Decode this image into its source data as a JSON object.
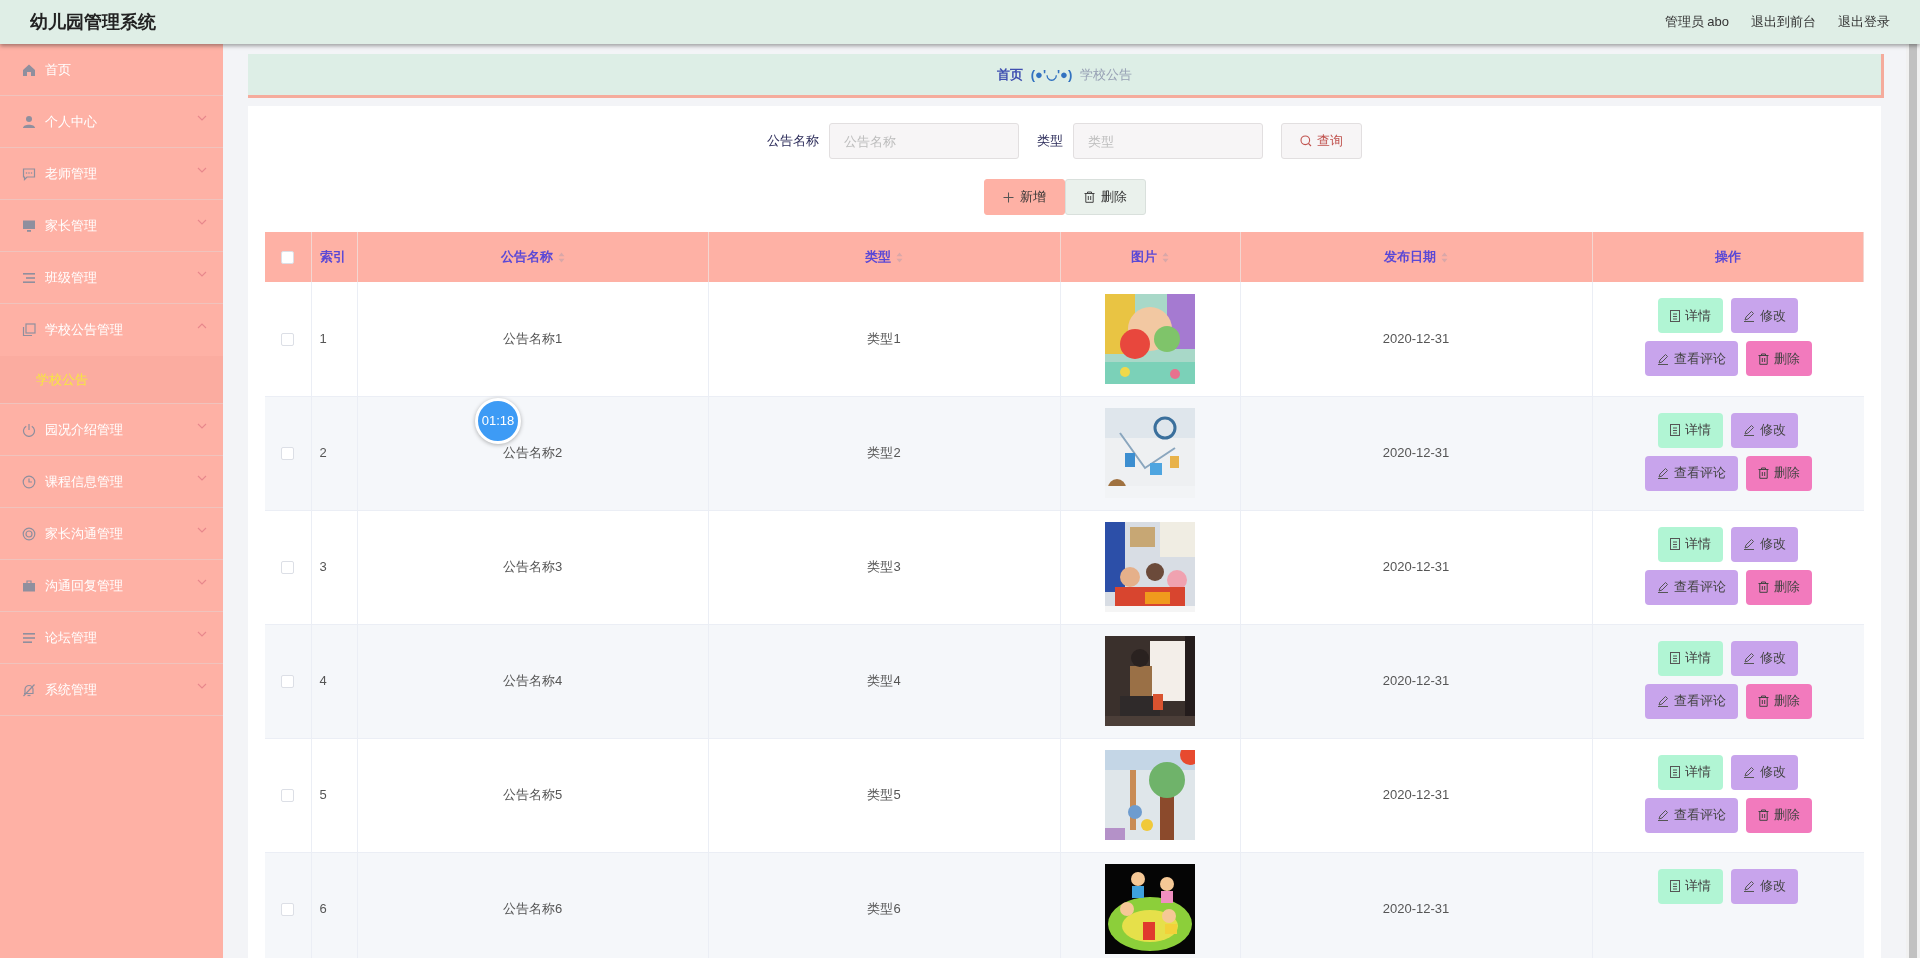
{
  "header": {
    "title": "幼儿园管理系统",
    "links": [
      "管理员 abo",
      "退出到前台",
      "退出登录"
    ]
  },
  "sidebar": {
    "items": [
      {
        "label": "首页",
        "kind": "home"
      },
      {
        "label": "个人中心",
        "kind": "user",
        "expanded": false
      },
      {
        "label": "老师管理",
        "kind": "chat",
        "expanded": false
      },
      {
        "label": "家长管理",
        "kind": "monitor",
        "expanded": false
      },
      {
        "label": "班级管理",
        "kind": "list",
        "expanded": false
      },
      {
        "label": "学校公告管理",
        "kind": "copy",
        "expanded": true,
        "children": [
          {
            "label": "学校公告",
            "selected": true
          }
        ]
      },
      {
        "label": "园况介绍管理",
        "kind": "power",
        "expanded": false
      },
      {
        "label": "课程信息管理",
        "kind": "clock",
        "expanded": false
      },
      {
        "label": "家长沟通管理",
        "kind": "ring",
        "expanded": false
      },
      {
        "label": "沟通回复管理",
        "kind": "briefcase",
        "expanded": false
      },
      {
        "label": "论坛管理",
        "kind": "menu",
        "expanded": false
      },
      {
        "label": "系统管理",
        "kind": "bell",
        "expanded": false
      }
    ]
  },
  "breadcrumb": {
    "home": "首页",
    "separator": "(●'◡'●)",
    "current": "学校公告"
  },
  "search": {
    "fields": [
      {
        "label": "公告名称",
        "placeholder": "公告名称"
      },
      {
        "label": "类型",
        "placeholder": "类型"
      }
    ],
    "button": "查询"
  },
  "toolbar": [
    {
      "label": "新增",
      "kind": "add"
    },
    {
      "label": "删除",
      "kind": "delete"
    }
  ],
  "table": {
    "select_all": false,
    "columns": [
      {
        "label": "索引",
        "sortable": false
      },
      {
        "label": "公告名称",
        "sortable": true
      },
      {
        "label": "类型",
        "sortable": true
      },
      {
        "label": "图片",
        "sortable": true
      },
      {
        "label": "发布日期",
        "sortable": true
      },
      {
        "label": "操作",
        "sortable": false
      }
    ],
    "rows": [
      {
        "checked": false,
        "index": "1",
        "name": "公告名称1",
        "type": "类型1",
        "date": "2020-12-31",
        "actions": [
          {
            "label": "详情",
            "kind": "detail"
          },
          {
            "label": "修改",
            "kind": "edit"
          },
          {
            "label": "查看评论",
            "kind": "comments"
          },
          {
            "label": "删除",
            "kind": "delete"
          }
        ]
      },
      {
        "checked": false,
        "index": "2",
        "name": "公告名称2",
        "type": "类型2",
        "date": "2020-12-31",
        "actions": [
          {
            "label": "详情",
            "kind": "detail"
          },
          {
            "label": "修改",
            "kind": "edit"
          },
          {
            "label": "查看评论",
            "kind": "comments"
          },
          {
            "label": "删除",
            "kind": "delete"
          }
        ]
      },
      {
        "checked": false,
        "index": "3",
        "name": "公告名称3",
        "type": "类型3",
        "date": "2020-12-31",
        "actions": [
          {
            "label": "详情",
            "kind": "detail"
          },
          {
            "label": "修改",
            "kind": "edit"
          },
          {
            "label": "查看评论",
            "kind": "comments"
          },
          {
            "label": "删除",
            "kind": "delete"
          }
        ]
      },
      {
        "checked": false,
        "index": "4",
        "name": "公告名称4",
        "type": "类型4",
        "date": "2020-12-31",
        "actions": [
          {
            "label": "详情",
            "kind": "detail"
          },
          {
            "label": "修改",
            "kind": "edit"
          },
          {
            "label": "查看评论",
            "kind": "comments"
          },
          {
            "label": "删除",
            "kind": "delete"
          }
        ]
      },
      {
        "checked": false,
        "index": "5",
        "name": "公告名称5",
        "type": "类型5",
        "date": "2020-12-31",
        "actions": [
          {
            "label": "详情",
            "kind": "detail"
          },
          {
            "label": "修改",
            "kind": "edit"
          },
          {
            "label": "查看评论",
            "kind": "comments"
          },
          {
            "label": "删除",
            "kind": "delete"
          }
        ]
      },
      {
        "checked": false,
        "index": "6",
        "name": "公告名称6",
        "type": "类型6",
        "date": "2020-12-31",
        "actions": [
          {
            "label": "详情",
            "kind": "detail"
          },
          {
            "label": "修改",
            "kind": "edit"
          }
        ]
      }
    ]
  },
  "timer": {
    "text": "01:18"
  }
}
